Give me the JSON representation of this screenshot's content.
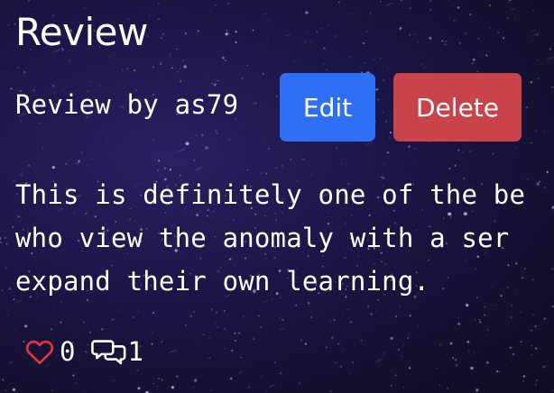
{
  "review": {
    "title": "Review",
    "byline": "Review by as79",
    "edit_label": "Edit",
    "delete_label": "Delete",
    "body": "This is definitely one of the be\nwho view the anomaly with a ser\nexpand their own learning."
  },
  "stats": {
    "likes": "0",
    "comments": "1"
  },
  "colors": {
    "edit_button": "#2f6ff5",
    "delete_button": "#c9434a",
    "heart": "#e0363b",
    "text": "#ffffff"
  },
  "icons": {
    "like": "heart-icon",
    "comment": "comments-icon"
  }
}
